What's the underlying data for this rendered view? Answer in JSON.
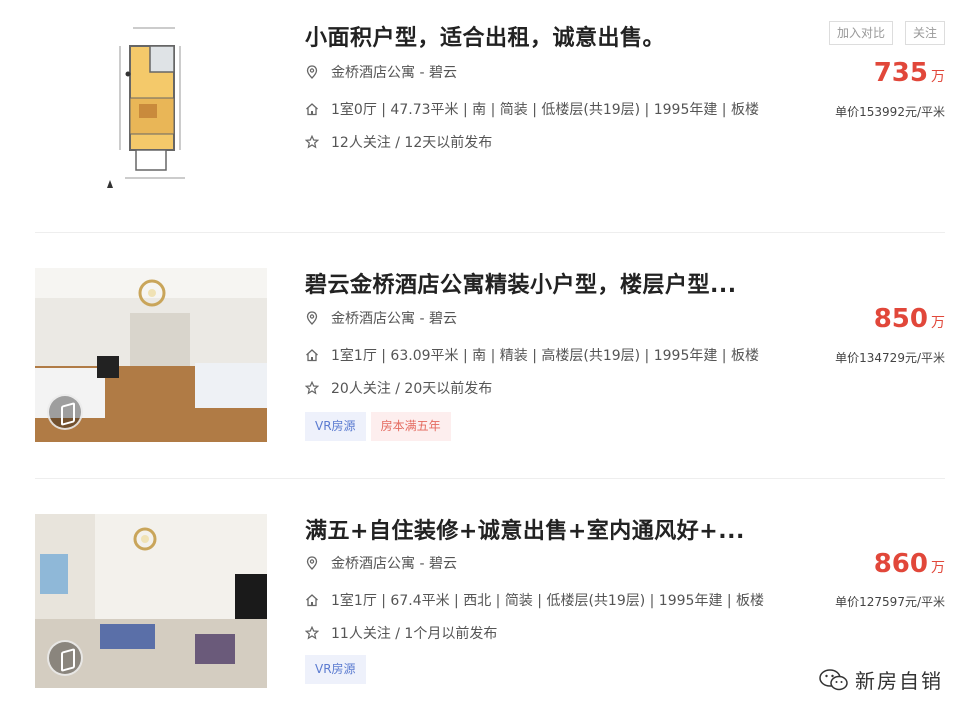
{
  "listings": [
    {
      "title": "小面积户型，适合出租，诚意出售。",
      "address": "金桥酒店公寓 - 碧云",
      "info": "1室0厅 | 47.73平米 | 南 | 简装 | 低楼层(共19层) | 1995年建 | 板楼",
      "follow": "12人关注 / 12天以前发布",
      "price": "735",
      "price_unit": "万",
      "unit_price": "单价153992元/平米",
      "compare_label": "加入对比",
      "favorite_label": "关注",
      "tags": []
    },
    {
      "title": "碧云金桥酒店公寓精装小户型，楼层户型...",
      "address": "金桥酒店公寓 - 碧云",
      "info": "1室1厅 | 63.09平米 | 南 | 精装 | 高楼层(共19层) | 1995年建 | 板楼",
      "follow": "20人关注 / 20天以前发布",
      "price": "850",
      "price_unit": "万",
      "unit_price": "单价134729元/平米",
      "tags": [
        "VR房源",
        "房本满五年"
      ]
    },
    {
      "title": "满五+自住装修+诚意出售+室内通风好+...",
      "address": "金桥酒店公寓 - 碧云",
      "info": "1室1厅 | 67.4平米 | 西北 | 简装 | 低楼层(共19层) | 1995年建 | 板楼",
      "follow": "11人关注 / 1个月以前发布",
      "price": "860",
      "price_unit": "万",
      "unit_price": "单价127597元/平米",
      "tags": [
        "VR房源"
      ]
    }
  ],
  "watermark": "新房自销",
  "colors": {
    "price": "#e1473a",
    "vr_tag_bg": "#eef1fb",
    "vr_tag_text": "#5b7bd0",
    "five_tag_bg": "#fdeeee",
    "five_tag_text": "#e46a5f"
  }
}
